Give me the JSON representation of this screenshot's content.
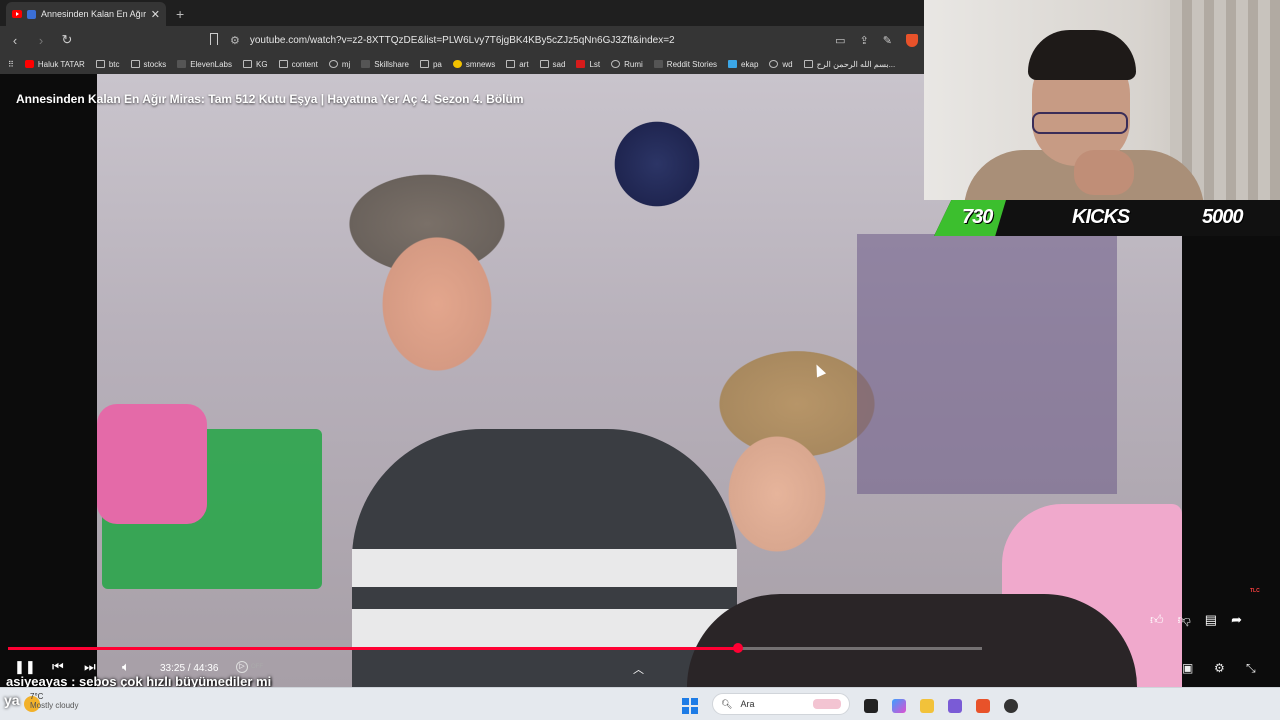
{
  "browser": {
    "tab_title": "Annesinden Kalan En Ağır Mi",
    "new_tab": "+",
    "tab_close": "✕",
    "url": "youtube.com/watch?v=z2-8XTTQzDE&list=PLW6Lvy7T6jgBK4KBy5cZJz5qNn6GJ3Zft&index=2",
    "nav": {
      "back": "‹",
      "forward": "›",
      "reload": "↻",
      "bookmark": "🔖"
    },
    "bookmarks": [
      {
        "label": "Haluk TATAR",
        "icon": "youtube-icon"
      },
      {
        "label": "btc",
        "icon": "folder-icon"
      },
      {
        "label": "stocks",
        "icon": "folder-icon"
      },
      {
        "label": "ElevenLabs",
        "icon": "elevenlabs-icon"
      },
      {
        "label": "KG",
        "icon": "folder-icon"
      },
      {
        "label": "content",
        "icon": "folder-icon"
      },
      {
        "label": "mj",
        "icon": "github-icon"
      },
      {
        "label": "Skillshare",
        "icon": "skillshare-icon"
      },
      {
        "label": "pa",
        "icon": "folder-icon"
      },
      {
        "label": "smnews",
        "icon": "smiley-icon"
      },
      {
        "label": "art",
        "icon": "folder-icon"
      },
      {
        "label": "sad",
        "icon": "slash-icon"
      },
      {
        "label": "Lst",
        "icon": "s-logo-icon"
      },
      {
        "label": "Rumi",
        "icon": "globe-icon"
      },
      {
        "label": "Reddit Stories",
        "icon": "d-logo-icon"
      },
      {
        "label": "ekap",
        "icon": "bird-icon"
      },
      {
        "label": "wd",
        "icon": "wd-icon"
      },
      {
        "label": "بسم الله الرحمن الرح...",
        "icon": "doc-icon"
      }
    ]
  },
  "video": {
    "title": "Annesinden Kalan En Ağır Miras: Tam 512 Kutu Eşya | Hayatına Yer Aç 4. Sezon 4. Bölüm",
    "current_time": "33:25",
    "separator": " / ",
    "duration": "44:36",
    "progress": 0.749,
    "autoplay_label": "OFF",
    "channel_badge": "TLC"
  },
  "overlay": {
    "kicks_count": "730",
    "kicks_label": "KICKS",
    "kicks_goal": "5000"
  },
  "chat": {
    "username": "asiyeayas",
    "separator": " : ",
    "message": "sebos çok hızlı büyümediler mi"
  },
  "taskbar": {
    "weather_temp": "7°C",
    "weather_desc": "Mostly cloudy",
    "search_placeholder": "Ara"
  },
  "colors": {
    "progress": "#ff0033",
    "kicks_green": "#3cbf2e",
    "windows_blue": "#1e7ce6"
  }
}
